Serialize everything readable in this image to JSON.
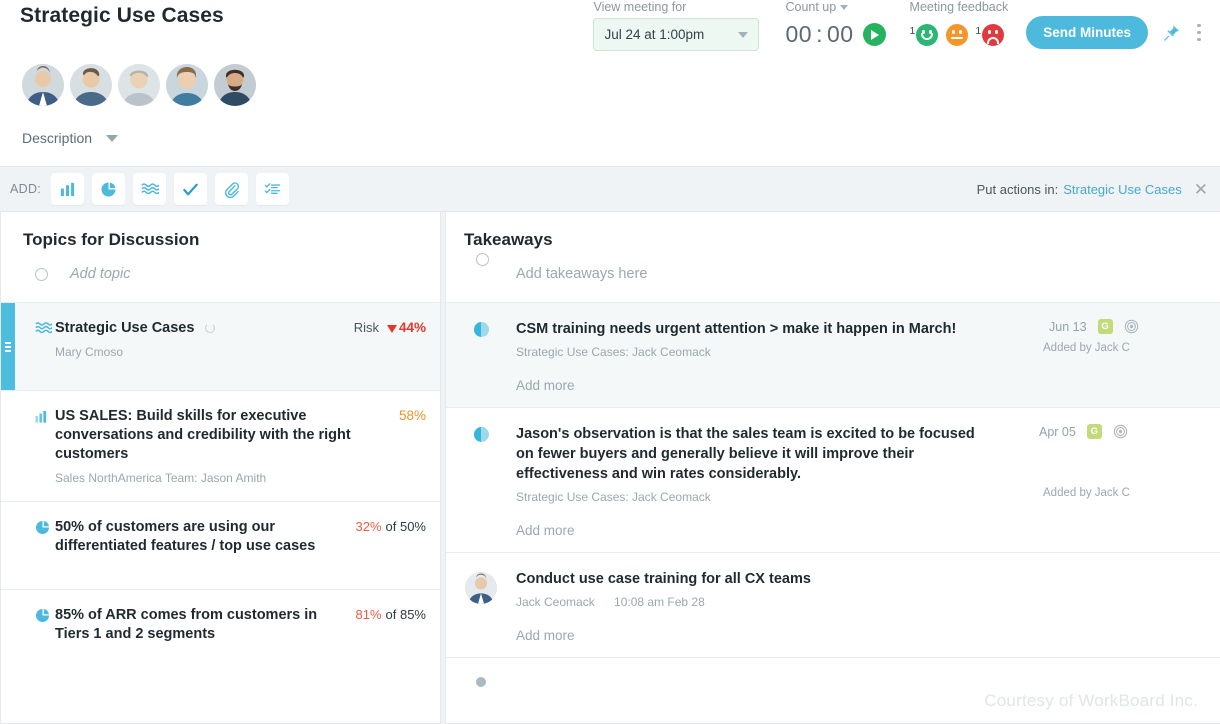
{
  "header": {
    "page_title": "Strategic Use Cases",
    "view_meeting_label": "View meeting for",
    "meeting_value": "Jul 24 at 1:00pm",
    "count_label": "Count up",
    "timer_minutes": "00",
    "timer_separator": ":",
    "timer_seconds": "00",
    "play_icon": "play-icon",
    "feedback_label": "Meeting feedback",
    "feedback": [
      {
        "icon": "happy-face-icon",
        "count": "1",
        "color": "#2bb673"
      },
      {
        "icon": "neutral-face-icon",
        "count": "",
        "color": "#f5952a"
      },
      {
        "icon": "sad-face-icon",
        "count": "1",
        "color": "#e03a3f"
      }
    ],
    "send_minutes_label": "Send Minutes",
    "pin_icon": "pushpin-icon",
    "more_icon": "kebab-menu-icon",
    "description_label": "Description",
    "description_chevron": "chevron-down-icon",
    "avatars": [
      "avatar-1",
      "avatar-2",
      "avatar-3",
      "avatar-4",
      "avatar-5"
    ]
  },
  "addbar": {
    "label": "ADD:",
    "buttons": [
      {
        "icon": "bar-chart-icon",
        "name": "add-metric"
      },
      {
        "icon": "pie-chart-icon",
        "name": "add-kpi"
      },
      {
        "icon": "waves-icon",
        "name": "add-goal"
      },
      {
        "icon": "check-icon",
        "name": "add-action"
      },
      {
        "icon": "paperclip-icon",
        "name": "add-attachment"
      },
      {
        "icon": "checklist-icon",
        "name": "add-list"
      }
    ],
    "put_actions_label": "Put actions in:",
    "put_actions_target": "Strategic Use Cases",
    "close_icon": "close-icon"
  },
  "topics": {
    "title": "Topics for Discussion",
    "add_placeholder": "Add topic",
    "items": [
      {
        "icon": "waves-icon",
        "title": "Strategic Use Cases",
        "subtitle": "Mary Cmoso",
        "status_label": "Risk",
        "value": "44%",
        "value_prefix": "▼",
        "value_style": "red",
        "selected": true,
        "spinner": true
      },
      {
        "icon": "bar-chart-icon",
        "title": "US SALES: Build skills for executive conversations and credibility with the right customers",
        "subtitle": "Sales NorthAmerica Team: Jason Amith",
        "status_label": "",
        "value": "58%",
        "value_style": "orange",
        "selected": false,
        "spinner": false
      },
      {
        "icon": "pie-chart-icon",
        "title": "50% of customers are using our differentiated features / top use cases",
        "subtitle": "",
        "status_label": "",
        "value": "32%",
        "value_suffix": "of 50%",
        "value_style": "coral",
        "selected": false,
        "spinner": false
      },
      {
        "icon": "pie-chart-icon",
        "title": "85% of ARR comes from customers in Tiers 1 and 2 segments",
        "subtitle": "",
        "status_label": "",
        "value": "81%",
        "value_suffix": "of 85%",
        "value_style": "coral",
        "selected": false,
        "spinner": false
      }
    ]
  },
  "takeaways": {
    "title": "Takeaways",
    "add_placeholder": "Add takeaways here",
    "items": [
      {
        "bullet": "half-circle-icon",
        "text": "CSM training needs urgent attention > make it happen in March!",
        "source": "Strategic Use Cases: Jack Ceomack",
        "add_more": "Add more",
        "date": "Jun 13",
        "badge": "G",
        "target_icon": "target-icon",
        "added_by": "Added by Jack C",
        "tinted": true
      },
      {
        "bullet": "half-circle-icon",
        "text": "Jason's observation is that the sales team is excited to be focused on fewer buyers and generally believe it will improve their effectiveness and win rates considerably.",
        "source": "Strategic Use Cases: Jack Ceomack",
        "add_more": "Add more",
        "date": "Apr 05",
        "badge": "G",
        "target_icon": "target-icon",
        "added_by": "Added by Jack C",
        "tinted": false
      },
      {
        "bullet": "avatar-icon",
        "text": "Conduct use case training for all CX teams",
        "source": "Jack Ceomack",
        "time": "10:08 am Feb 28",
        "add_more": "Add more",
        "tinted": false
      },
      {
        "bullet": "grey-dot-icon",
        "text": "",
        "tinted": false
      }
    ]
  },
  "footer": {
    "courtesy": "Courtesy of WorkBoard Inc."
  },
  "colors": {
    "accent": "#4cb9dd",
    "risk_red": "#e8352c",
    "orange": "#f0912e",
    "coral": "#f05a41",
    "green": "#2bb673",
    "badge_green": "#c2da7a"
  }
}
